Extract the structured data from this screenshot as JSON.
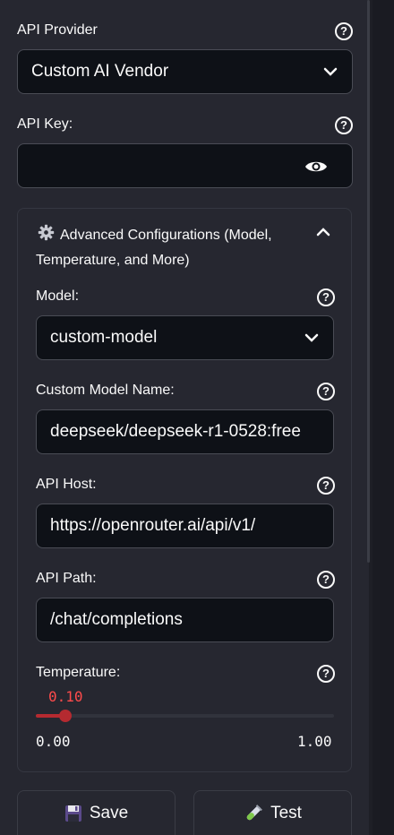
{
  "provider": {
    "label": "API Provider",
    "value": "Custom AI Vendor"
  },
  "api_key": {
    "label": "API Key:",
    "value": ""
  },
  "advanced": {
    "title": "Advanced Configurations (Model, Temperature, and More)"
  },
  "model": {
    "label": "Model:",
    "value": "custom-model"
  },
  "custom_model": {
    "label": "Custom Model Name:",
    "value": "deepseek/deepseek-r1-0528:free"
  },
  "api_host": {
    "label": "API Host:",
    "value": "https://openrouter.ai/api/v1/"
  },
  "api_path": {
    "label": "API Path:",
    "value": "/chat/completions"
  },
  "temperature": {
    "label": "Temperature:",
    "value": "0.10",
    "min": "0.00",
    "max": "1.00",
    "fraction": 0.1
  },
  "buttons": {
    "save": "Save",
    "test": "Test"
  },
  "help_glyph": "?",
  "colors": {
    "accent": "#ff4b4b",
    "slider_fill": "#b52a30",
    "field_bg": "#0e1117",
    "panel_bg": "#262730"
  },
  "icons": [
    "chevron-down-icon",
    "eye-icon",
    "gear-icon",
    "chevron-up-icon",
    "floppy-disk-icon",
    "test-tube-icon",
    "help-icon"
  ]
}
